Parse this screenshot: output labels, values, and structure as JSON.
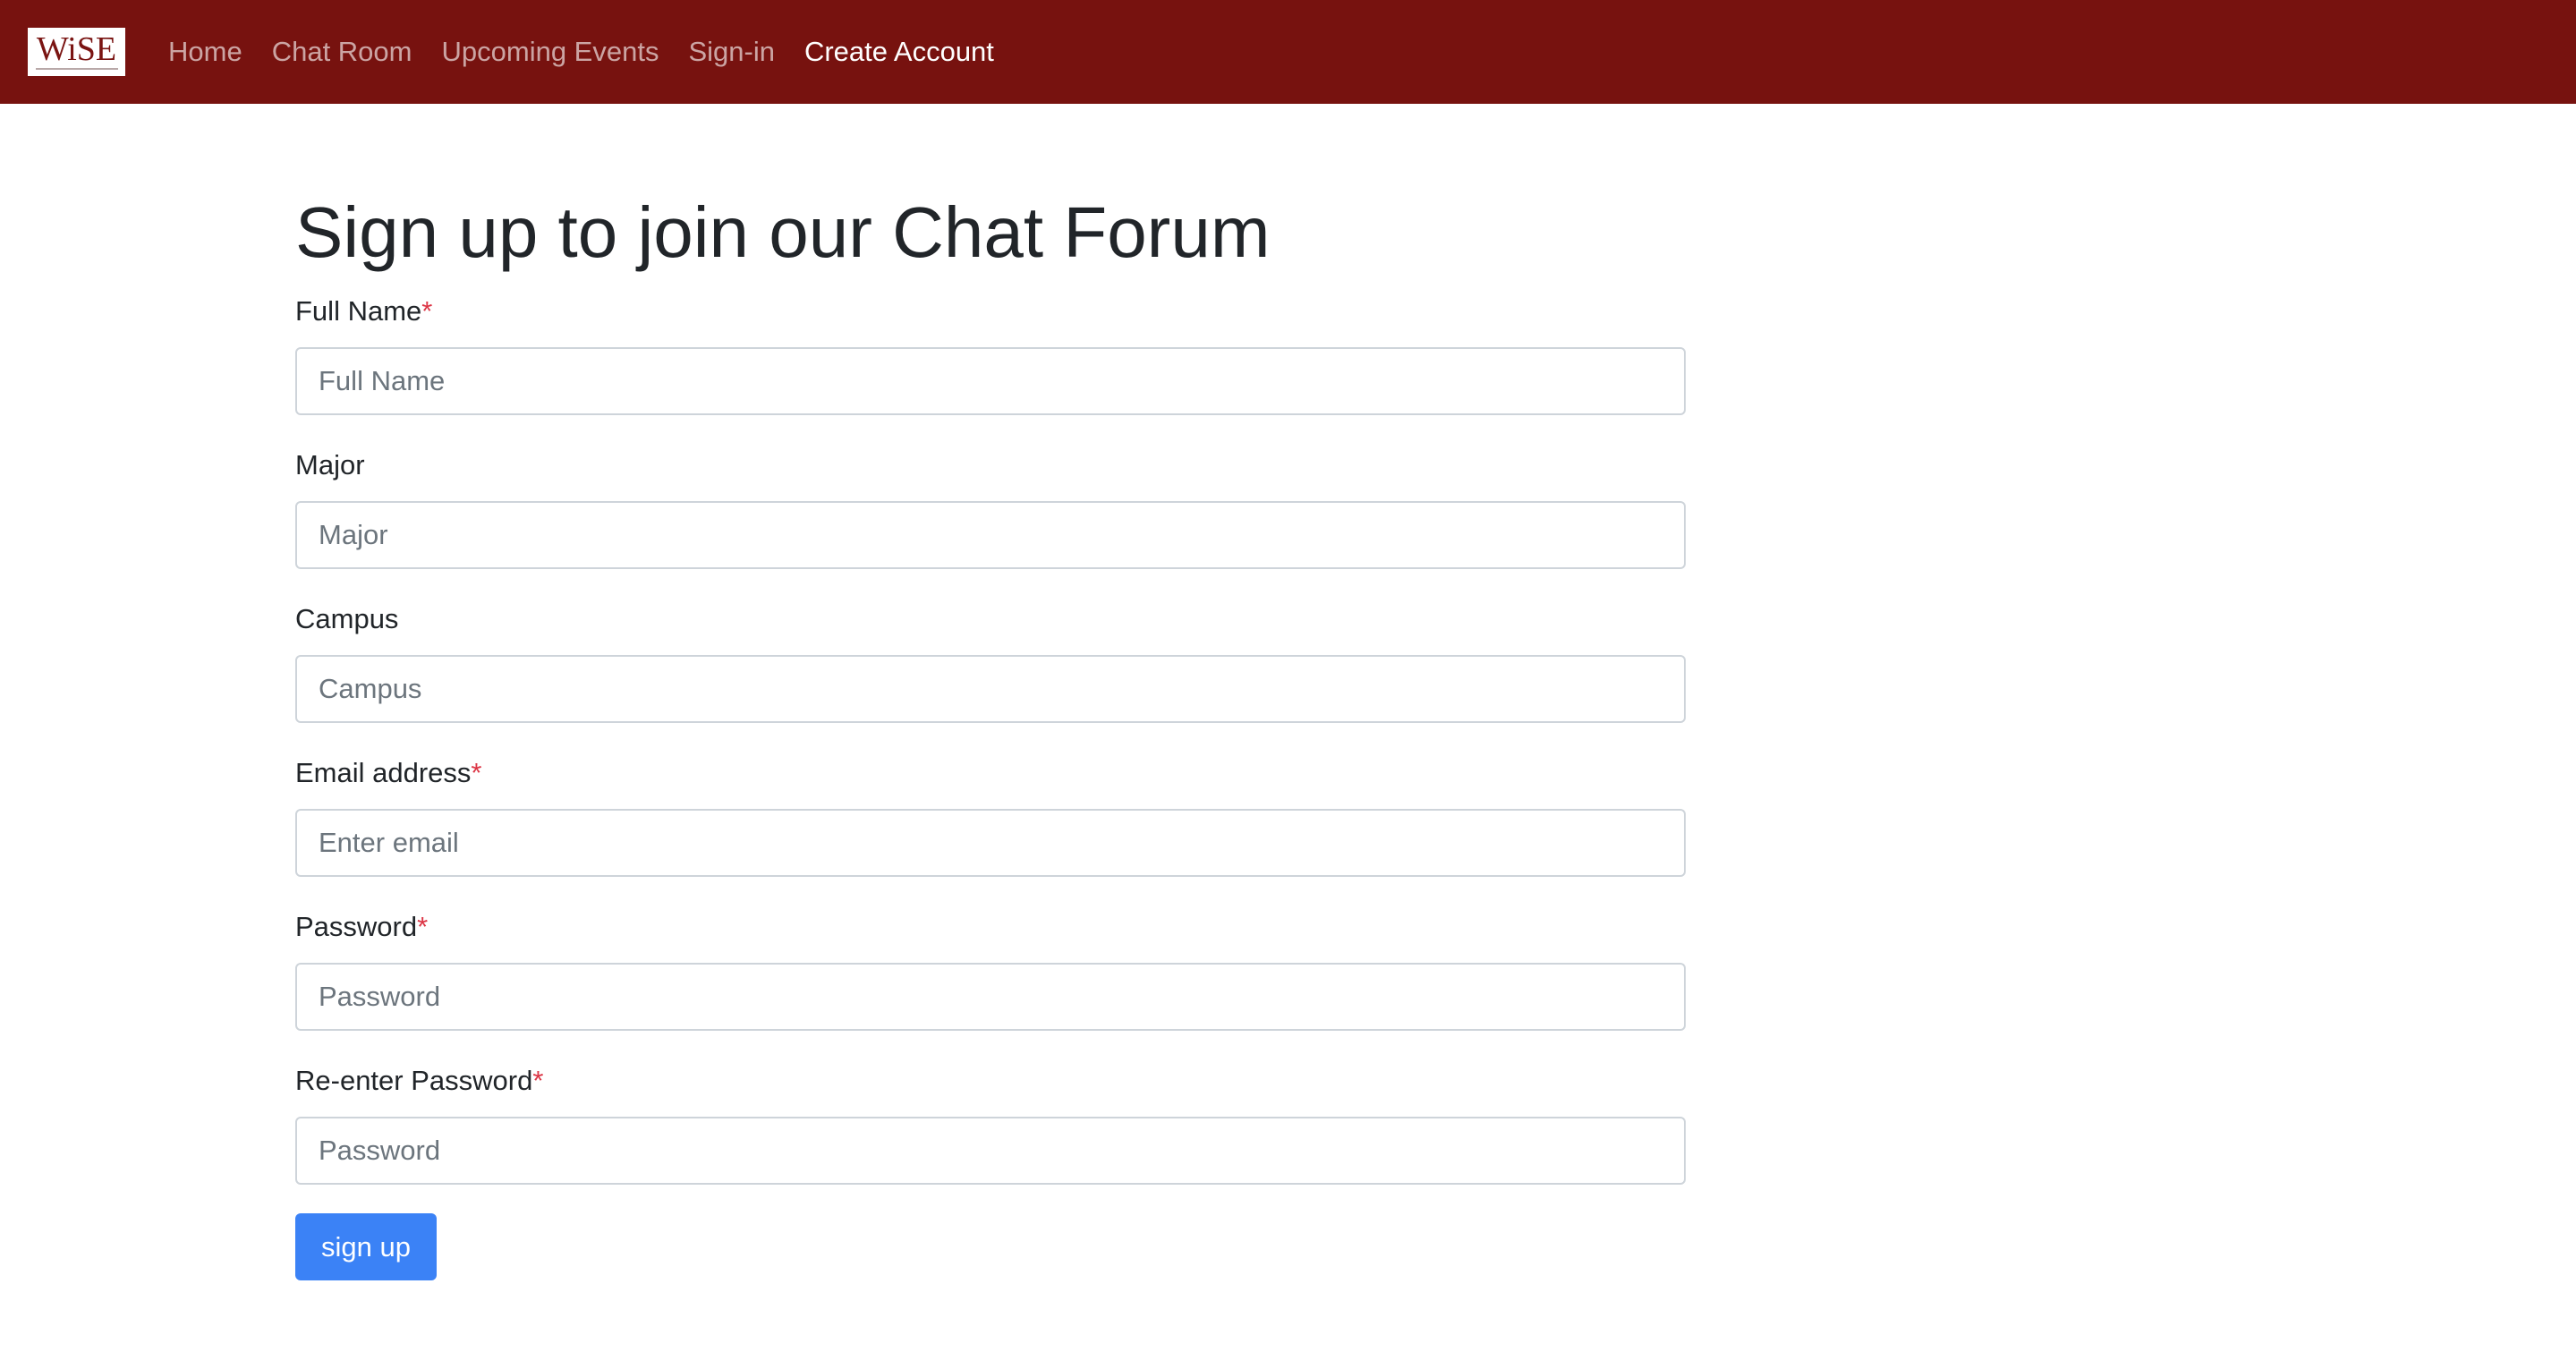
{
  "navbar": {
    "brand": "WiSE",
    "links": [
      {
        "label": "Home",
        "active": false
      },
      {
        "label": "Chat Room",
        "active": false
      },
      {
        "label": "Upcoming Events",
        "active": false
      },
      {
        "label": "Sign-in",
        "active": false
      },
      {
        "label": "Create Account",
        "active": true
      }
    ]
  },
  "form": {
    "title": "Sign up to join our Chat Forum",
    "required_marker": "*",
    "fields": [
      {
        "label": "Full Name",
        "required": true,
        "placeholder": "Full Name",
        "value": ""
      },
      {
        "label": "Major",
        "required": false,
        "placeholder": "Major",
        "value": ""
      },
      {
        "label": "Campus",
        "required": false,
        "placeholder": "Campus",
        "value": ""
      },
      {
        "label": "Email address",
        "required": true,
        "placeholder": "Enter email",
        "value": ""
      },
      {
        "label": "Password",
        "required": true,
        "placeholder": "Password",
        "value": ""
      },
      {
        "label": "Re-enter Password",
        "required": true,
        "placeholder": "Password",
        "value": ""
      }
    ],
    "submit_label": "sign up"
  },
  "colors": {
    "navbar_bg": "#77120f",
    "brand_text": "#7a1412",
    "required": "#dc3545",
    "button_bg": "#3b82f6"
  }
}
